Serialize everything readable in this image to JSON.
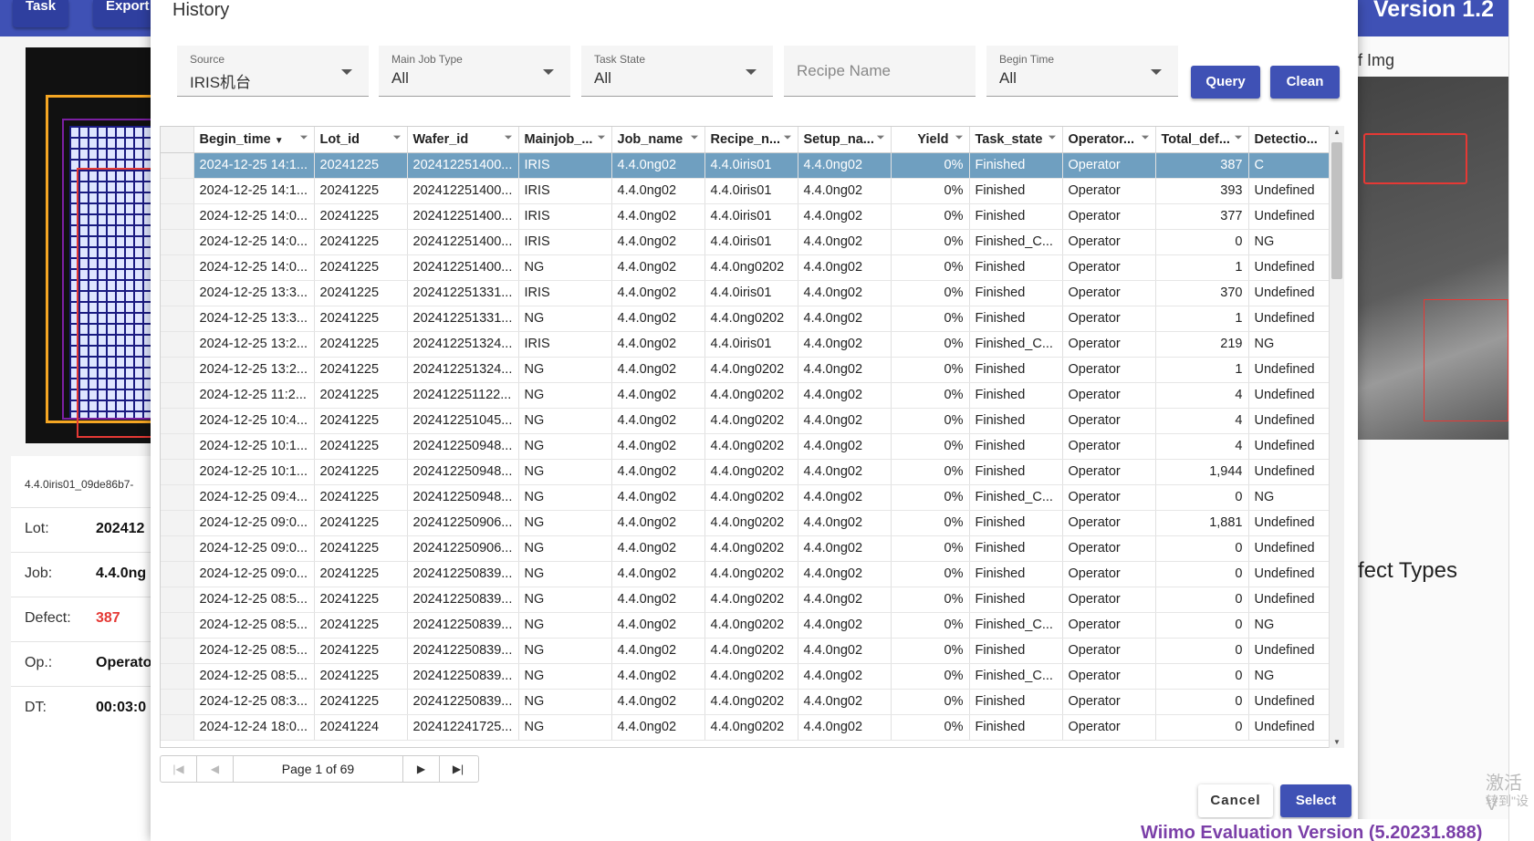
{
  "background": {
    "top_buttons": [
      "Task",
      "Export"
    ],
    "version": "Version 1.2",
    "left_panel": {
      "file_name": "4.4.0iris01_09de86b7-",
      "rows": [
        {
          "key": "Lot:",
          "value": "202412"
        },
        {
          "key": "Job:",
          "value": "4.4.0ng"
        },
        {
          "key": "Defect:",
          "value": "387"
        },
        {
          "key": "Op.:",
          "value": "Operato"
        },
        {
          "key": "DT:",
          "value": "00:03:0"
        }
      ]
    },
    "right_panel": {
      "image_label": "f Img",
      "defect_types_label": "fect Types"
    },
    "watermark": {
      "line1": "激活 V",
      "line2": "转到\"设"
    },
    "wiimo_banner": "Wiimo Evaluation Version (5.20231.888)"
  },
  "dialog": {
    "title": "History",
    "filters": {
      "source": {
        "label": "Source",
        "value": "IRIS机台"
      },
      "main_job_type": {
        "label": "Main Job Type",
        "value": "All"
      },
      "task_state": {
        "label": "Task State",
        "value": "All"
      },
      "recipe_name": {
        "placeholder": "Recipe Name"
      },
      "begin_time": {
        "label": "Begin Time",
        "value": "All"
      }
    },
    "query_label": "Query",
    "clean_label": "Clean",
    "columns": [
      "Begin_time",
      "Lot_id",
      "Wafer_id",
      "Mainjob_...",
      "Job_name",
      "Recipe_n...",
      "Setup_na...",
      "Yield",
      "Task_state",
      "Operator...",
      "Total_def...",
      "Detectio..."
    ],
    "rows": [
      [
        "2024-12-25 14:1...",
        "20241225",
        "202412251400...",
        "IRIS",
        "4.4.0ng02",
        "4.4.0iris01",
        "4.4.0ng02",
        "0%",
        "Finished",
        "Operator",
        "387",
        "C"
      ],
      [
        "2024-12-25 14:1...",
        "20241225",
        "202412251400...",
        "IRIS",
        "4.4.0ng02",
        "4.4.0iris01",
        "4.4.0ng02",
        "0%",
        "Finished",
        "Operator",
        "393",
        "Undefined"
      ],
      [
        "2024-12-25 14:0...",
        "20241225",
        "202412251400...",
        "IRIS",
        "4.4.0ng02",
        "4.4.0iris01",
        "4.4.0ng02",
        "0%",
        "Finished",
        "Operator",
        "377",
        "Undefined"
      ],
      [
        "2024-12-25 14:0...",
        "20241225",
        "202412251400...",
        "IRIS",
        "4.4.0ng02",
        "4.4.0iris01",
        "4.4.0ng02",
        "0%",
        "Finished_C...",
        "Operator",
        "0",
        "NG"
      ],
      [
        "2024-12-25 14:0...",
        "20241225",
        "202412251400...",
        "NG",
        "4.4.0ng02",
        "4.4.0ng0202",
        "4.4.0ng02",
        "0%",
        "Finished",
        "Operator",
        "1",
        "Undefined"
      ],
      [
        "2024-12-25 13:3...",
        "20241225",
        "202412251331...",
        "IRIS",
        "4.4.0ng02",
        "4.4.0iris01",
        "4.4.0ng02",
        "0%",
        "Finished",
        "Operator",
        "370",
        "Undefined"
      ],
      [
        "2024-12-25 13:3...",
        "20241225",
        "202412251331...",
        "NG",
        "4.4.0ng02",
        "4.4.0ng0202",
        "4.4.0ng02",
        "0%",
        "Finished",
        "Operator",
        "1",
        "Undefined"
      ],
      [
        "2024-12-25 13:2...",
        "20241225",
        "202412251324...",
        "IRIS",
        "4.4.0ng02",
        "4.4.0iris01",
        "4.4.0ng02",
        "0%",
        "Finished_C...",
        "Operator",
        "219",
        "NG"
      ],
      [
        "2024-12-25 13:2...",
        "20241225",
        "202412251324...",
        "NG",
        "4.4.0ng02",
        "4.4.0ng0202",
        "4.4.0ng02",
        "0%",
        "Finished",
        "Operator",
        "1",
        "Undefined"
      ],
      [
        "2024-12-25 11:2...",
        "20241225",
        "202412251122...",
        "NG",
        "4.4.0ng02",
        "4.4.0ng0202",
        "4.4.0ng02",
        "0%",
        "Finished",
        "Operator",
        "4",
        "Undefined"
      ],
      [
        "2024-12-25 10:4...",
        "20241225",
        "202412251045...",
        "NG",
        "4.4.0ng02",
        "4.4.0ng0202",
        "4.4.0ng02",
        "0%",
        "Finished",
        "Operator",
        "4",
        "Undefined"
      ],
      [
        "2024-12-25 10:1...",
        "20241225",
        "202412250948...",
        "NG",
        "4.4.0ng02",
        "4.4.0ng0202",
        "4.4.0ng02",
        "0%",
        "Finished",
        "Operator",
        "4",
        "Undefined"
      ],
      [
        "2024-12-25 10:1...",
        "20241225",
        "202412250948...",
        "NG",
        "4.4.0ng02",
        "4.4.0ng0202",
        "4.4.0ng02",
        "0%",
        "Finished",
        "Operator",
        "1,944",
        "Undefined"
      ],
      [
        "2024-12-25 09:4...",
        "20241225",
        "202412250948...",
        "NG",
        "4.4.0ng02",
        "4.4.0ng0202",
        "4.4.0ng02",
        "0%",
        "Finished_C...",
        "Operator",
        "0",
        "NG"
      ],
      [
        "2024-12-25 09:0...",
        "20241225",
        "202412250906...",
        "NG",
        "4.4.0ng02",
        "4.4.0ng0202",
        "4.4.0ng02",
        "0%",
        "Finished",
        "Operator",
        "1,881",
        "Undefined"
      ],
      [
        "2024-12-25 09:0...",
        "20241225",
        "202412250906...",
        "NG",
        "4.4.0ng02",
        "4.4.0ng0202",
        "4.4.0ng02",
        "0%",
        "Finished",
        "Operator",
        "0",
        "Undefined"
      ],
      [
        "2024-12-25 09:0...",
        "20241225",
        "202412250839...",
        "NG",
        "4.4.0ng02",
        "4.4.0ng0202",
        "4.4.0ng02",
        "0%",
        "Finished",
        "Operator",
        "0",
        "Undefined"
      ],
      [
        "2024-12-25 08:5...",
        "20241225",
        "202412250839...",
        "NG",
        "4.4.0ng02",
        "4.4.0ng0202",
        "4.4.0ng02",
        "0%",
        "Finished",
        "Operator",
        "0",
        "Undefined"
      ],
      [
        "2024-12-25 08:5...",
        "20241225",
        "202412250839...",
        "NG",
        "4.4.0ng02",
        "4.4.0ng0202",
        "4.4.0ng02",
        "0%",
        "Finished_C...",
        "Operator",
        "0",
        "NG"
      ],
      [
        "2024-12-25 08:5...",
        "20241225",
        "202412250839...",
        "NG",
        "4.4.0ng02",
        "4.4.0ng0202",
        "4.4.0ng02",
        "0%",
        "Finished",
        "Operator",
        "0",
        "Undefined"
      ],
      [
        "2024-12-25 08:5...",
        "20241225",
        "202412250839...",
        "NG",
        "4.4.0ng02",
        "4.4.0ng0202",
        "4.4.0ng02",
        "0%",
        "Finished_C...",
        "Operator",
        "0",
        "NG"
      ],
      [
        "2024-12-25 08:3...",
        "20241225",
        "202412250839...",
        "NG",
        "4.4.0ng02",
        "4.4.0ng0202",
        "4.4.0ng02",
        "0%",
        "Finished",
        "Operator",
        "0",
        "Undefined"
      ],
      [
        "2024-12-24 18:0...",
        "20241224",
        "202412241725...",
        "NG",
        "4.4.0ng02",
        "4.4.0ng0202",
        "4.4.0ng02",
        "0%",
        "Finished",
        "Operator",
        "0",
        "Undefined"
      ]
    ],
    "selected_row": 0,
    "pager_text": "Page 1 of 69",
    "cancel_label": "Cancel",
    "select_label": "Select"
  },
  "colors": {
    "primary": "#3f51b5",
    "selected_row": "#6f9fc0",
    "defect_value": "#e53935",
    "highlight_box": "#e53935",
    "banner_text": "#7b3fa8"
  }
}
